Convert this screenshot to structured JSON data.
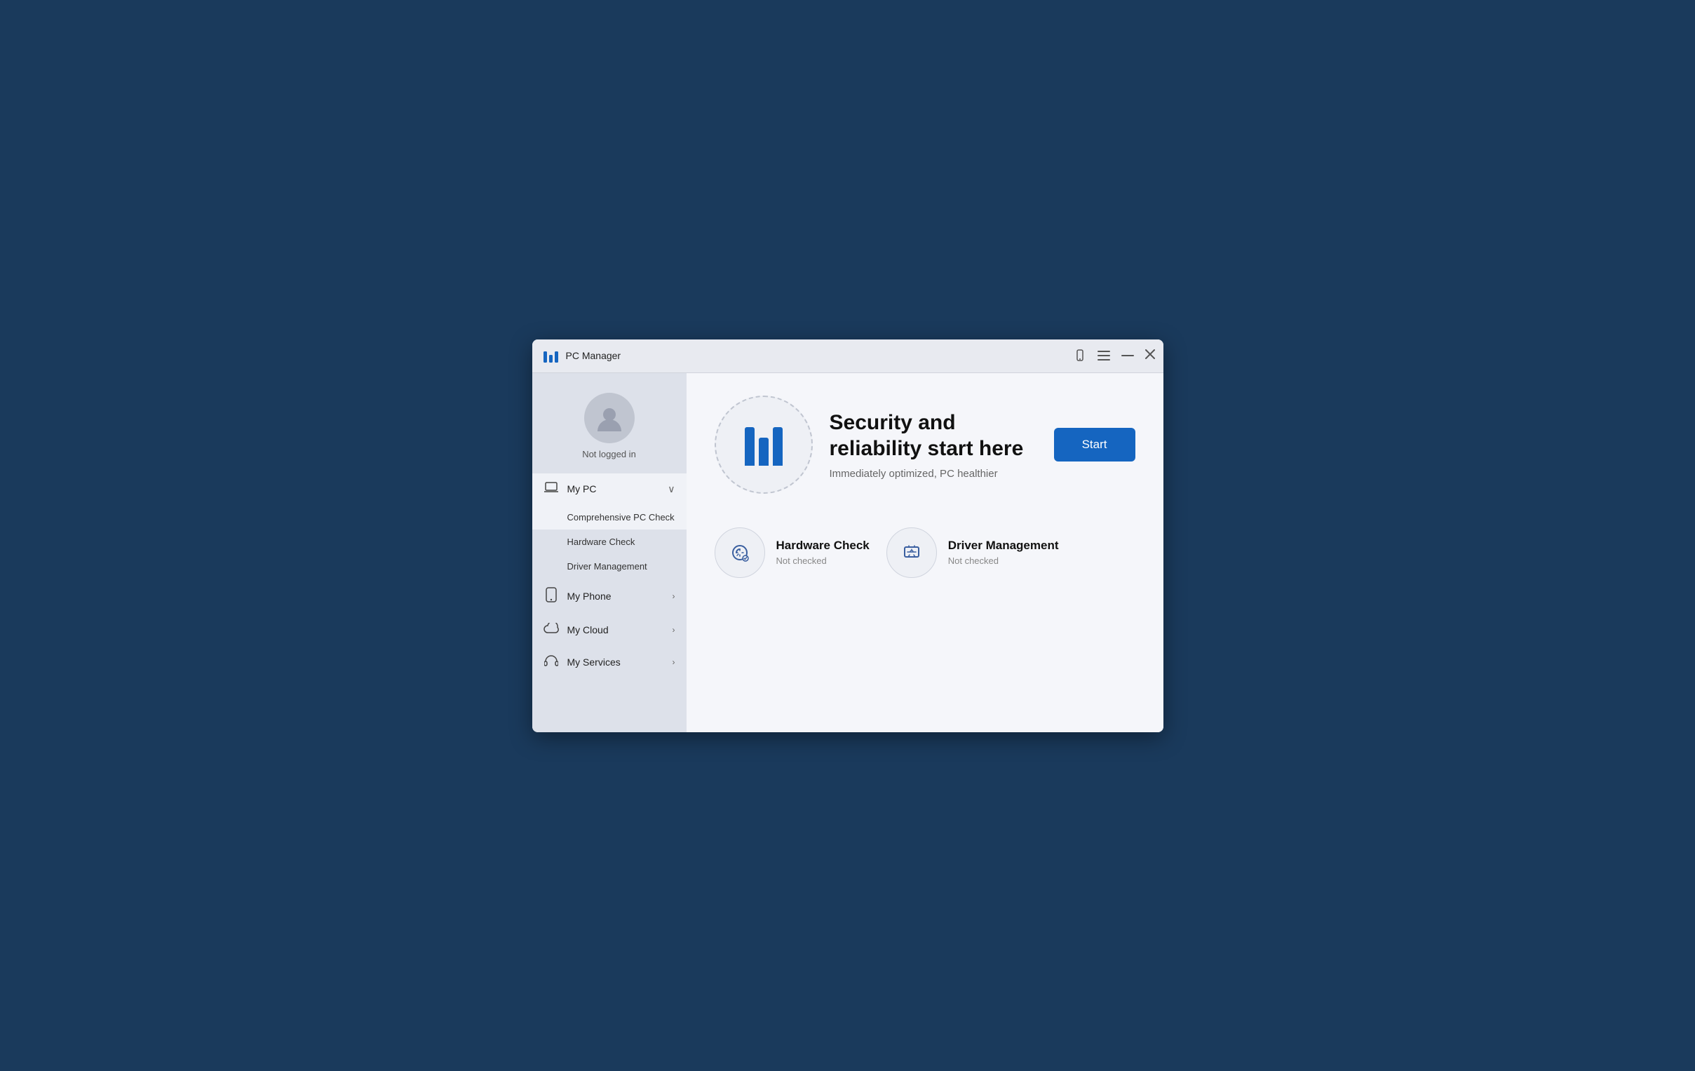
{
  "titleBar": {
    "title": "PC Manager",
    "controls": {
      "phone": "📱",
      "menu": "☰",
      "minimize": "─",
      "close": "✕"
    }
  },
  "sidebar": {
    "user": {
      "status": "Not logged in"
    },
    "navItems": [
      {
        "id": "my-pc",
        "label": "My PC",
        "icon": "laptop",
        "expanded": true,
        "chevron": "∨",
        "subItems": [
          {
            "id": "comprehensive-pc-check",
            "label": "Comprehensive PC Check",
            "active": true
          },
          {
            "id": "hardware-check",
            "label": "Hardware Check",
            "active": false
          },
          {
            "id": "driver-management",
            "label": "Driver Management",
            "active": false
          }
        ]
      },
      {
        "id": "my-phone",
        "label": "My Phone",
        "icon": "phone",
        "chevron": "›"
      },
      {
        "id": "my-cloud",
        "label": "My Cloud",
        "icon": "cloud",
        "chevron": "›"
      },
      {
        "id": "my-services",
        "label": "My Services",
        "icon": "headset",
        "chevron": "›"
      }
    ]
  },
  "content": {
    "hero": {
      "title": "Security and reliability start here",
      "subtitle": "Immediately optimized, PC healthier",
      "startButton": "Start"
    },
    "cards": [
      {
        "id": "hardware-check",
        "title": "Hardware Check",
        "status": "Not checked"
      },
      {
        "id": "driver-management",
        "title": "Driver Management",
        "status": "Not checked"
      }
    ]
  }
}
